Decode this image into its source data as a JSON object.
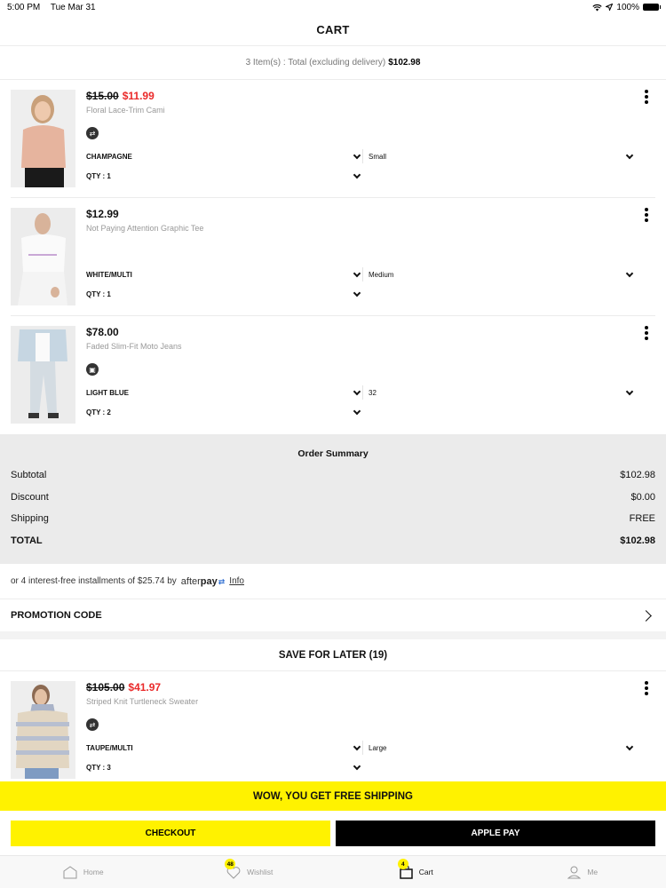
{
  "status_bar": {
    "time": "5:00 PM",
    "date": "Tue Mar 31",
    "battery": "100%"
  },
  "header": {
    "title": "CART"
  },
  "cart_summary_line": {
    "text": "3 Item(s) : Total (excluding delivery)",
    "amount": "$102.98"
  },
  "cart_items": [
    {
      "price_original": "$15.00",
      "price_sale": "$11.99",
      "name": "Floral Lace-Trim Cami",
      "badge_icon": "arrows-swap-icon",
      "color": "CHAMPAGNE",
      "size": "Small",
      "qty_label": "QTY : 1",
      "thumb_bg": "#e9c3b0"
    },
    {
      "price_original": "",
      "price_sale": "$12.99",
      "name": "Not Paying Attention Graphic Tee",
      "badge_icon": "",
      "color": "WHITE/MULTI",
      "size": "Medium",
      "qty_label": "QTY : 1",
      "thumb_bg": "#f0f0f0"
    },
    {
      "price_original": "",
      "price_sale": "$78.00",
      "name": "Faded Slim-Fit Moto Jeans",
      "badge_icon": "box-icon",
      "color": "LIGHT BLUE",
      "size": "32",
      "qty_label": "QTY : 2",
      "thumb_bg": "#d7dde2"
    }
  ],
  "order_summary": {
    "title": "Order Summary",
    "rows": [
      {
        "label": "Subtotal",
        "value": "$102.98"
      },
      {
        "label": "Discount",
        "value": "$0.00"
      },
      {
        "label": "Shipping",
        "value": "FREE"
      },
      {
        "label": "TOTAL",
        "value": "$102.98"
      }
    ]
  },
  "afterpay": {
    "text": "or 4 interest-free installments of $25.74 by",
    "logo_light": "after",
    "logo_bold": "pay",
    "link": "Info"
  },
  "promotion": {
    "label": "PROMOTION CODE"
  },
  "save_for_later": {
    "title": "SAVE FOR LATER (19)",
    "items": [
      {
        "price_original": "$105.00",
        "price_sale": "$41.97",
        "name": "Striped Knit Turtleneck Sweater",
        "badge_icon": "arrows-swap-icon",
        "color": "TAUPE/MULTI",
        "size": "Large",
        "qty_label": "QTY : 3",
        "thumb_bg": "#d9cfc0"
      }
    ]
  },
  "banner": {
    "text": "WOW, YOU GET FREE SHIPPING"
  },
  "actions": {
    "checkout": "CHECKOUT",
    "apple_pay": "APPLE PAY"
  },
  "tabbar": {
    "tabs": [
      {
        "label": "Home",
        "icon": "home-icon",
        "badge": ""
      },
      {
        "label": "Wishlist",
        "icon": "heart-icon",
        "badge": "48"
      },
      {
        "label": "Cart",
        "icon": "bag-icon",
        "badge": "4",
        "active": true
      },
      {
        "label": "Me",
        "icon": "user-icon",
        "badge": ""
      }
    ]
  },
  "colors": {
    "accent_yellow": "#fff200",
    "sale_red": "#ea2a2a",
    "summary_bg": "#ebebeb"
  }
}
